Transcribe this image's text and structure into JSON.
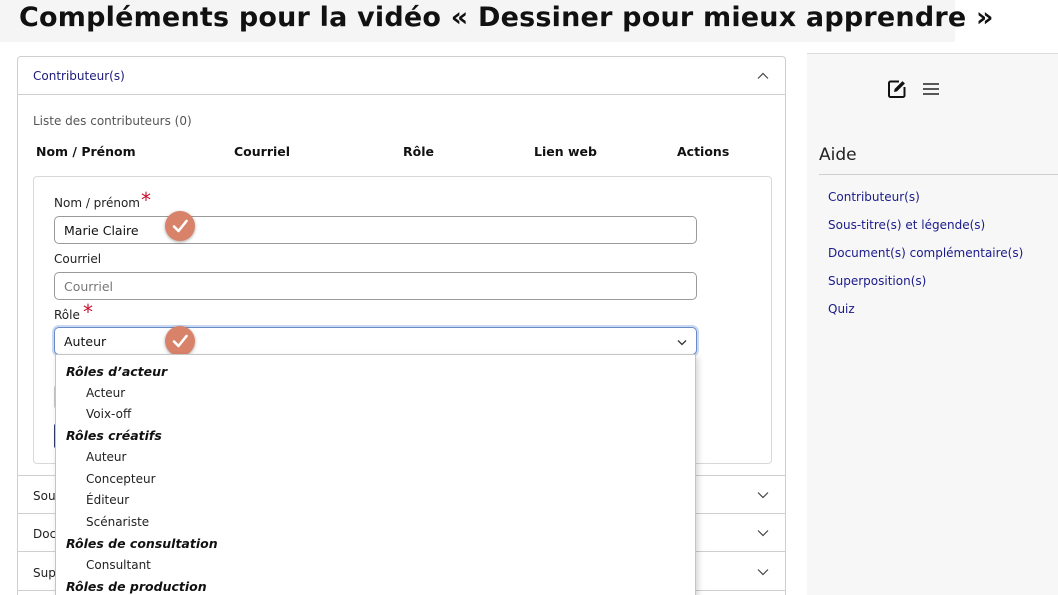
{
  "page": {
    "title": "Compléments pour la vidéo « Dessiner pour mieux apprendre »"
  },
  "accordion": {
    "contributors": {
      "header": "Contributeur(s)",
      "list_caption": "Liste des contributeurs (0)",
      "columns": [
        "Nom / Prénom",
        "Courriel",
        "Rôle",
        "Lien web",
        "Actions"
      ],
      "form": {
        "name_label": "Nom / prénom",
        "name_value": "Marie Claire",
        "email_label": "Courriel",
        "email_placeholder": "Courriel",
        "role_label": "Rôle",
        "role_value": "Auteur",
        "required_mark": "*"
      }
    },
    "sections": [
      {
        "label": "Sou"
      },
      {
        "label": "Doc"
      },
      {
        "label": "Sup"
      }
    ]
  },
  "role_dropdown": {
    "groups": [
      {
        "label": "Rôles d’acteur",
        "options": [
          "Acteur",
          "Voix-off"
        ]
      },
      {
        "label": "Rôles créatifs",
        "options": [
          "Auteur",
          "Concepteur",
          "Éditeur",
          "Scénariste"
        ]
      },
      {
        "label": "Rôles de consultation",
        "options": [
          "Consultant"
        ]
      },
      {
        "label": "Rôles de production",
        "options": []
      }
    ]
  },
  "help_panel": {
    "title": "Aide",
    "links": [
      "Contributeur(s)",
      "Sous-titre(s) et légende(s)",
      "Document(s) complémentaire(s)",
      "Superposition(s)",
      "Quiz"
    ]
  },
  "colors": {
    "link": "#1a1a8a",
    "required": "#c8102e",
    "check_badge": "#d9826a",
    "focus_border": "#6a8cc6"
  },
  "icons": [
    "edit-icon",
    "menu-icon",
    "chevron-up-icon",
    "chevron-down-icon",
    "check-icon"
  ]
}
